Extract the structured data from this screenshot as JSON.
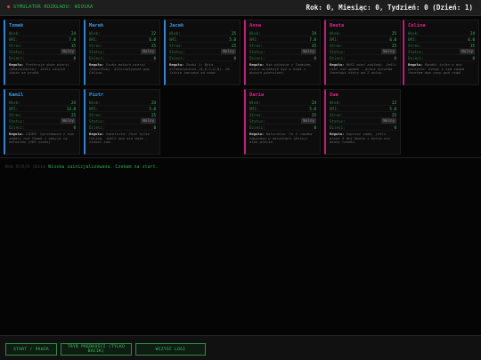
{
  "header": {
    "title": "SYMULATOR ROZKŁADU: WIOSKA",
    "clock": "Rok: 0, Miesiąc: 0, Tydzień: 0 (Dzień: 1)"
  },
  "labels": {
    "age": "Wiek:",
    "bmi": "BMI:",
    "stress": "Stres:",
    "status": "Status:",
    "children": "Dzieci:",
    "rule": "Reguła:"
  },
  "villagers": [
    {
      "name": "Tomek",
      "gender": "male",
      "age": "24",
      "bmi": "7.0",
      "stress": "35",
      "status": "Wolny",
      "children": "0",
      "rule": "Preferuje duże piersi (Beata/Daria). Jeśli wszyte - idzie na przód."
    },
    {
      "name": "Marek",
      "gender": "male",
      "age": "22",
      "bmi": "6.0",
      "stress": "25",
      "status": "Wolny",
      "children": "0",
      "rule": "Szuka małych piersi (Anna/Ewa). Alternatywnie gdy Celina."
    },
    {
      "name": "Jacek",
      "gender": "male",
      "age": "25",
      "bmi": "5.0",
      "stress": "25",
      "status": "Wolny",
      "children": "0",
      "rule": "Znaki 1: Byta alfabetycznie (A,E,C,D,B). Ze liście zaczyna od nowa."
    },
    {
      "name": "Anna",
      "gender": "female",
      "age": "24",
      "bmi": "7.0",
      "stress": "35",
      "status": "Wolny",
      "children": "0",
      "rule": "Nie pójdzie z Tomkiem, który oczekuje być w kimś z dużych piersiach."
    },
    {
      "name": "Beata",
      "gender": "female",
      "age": "25",
      "bmi": "6.0",
      "stress": "25",
      "status": "Wolny",
      "children": "0",
      "rule": "MUSI mieć zakłady. Jeśli nikt nie wpada - praca sprzeda facetowi który ma 2 wolny."
    },
    {
      "name": "Celina",
      "gender": "female",
      "age": "24",
      "bmi": "6.0",
      "stress": "35",
      "status": "Wolny",
      "children": "0",
      "rule": "Randki tylko w dni parzyste. Kiedy z tym samym facetem dwa razy pod rząd."
    },
    {
      "name": "Kamil",
      "gender": "male",
      "age": "24",
      "bmi": "13.0",
      "stress": "25",
      "status": "Wolny",
      "children": "0",
      "rule": "LIDER: Sprzedawca z kim zadali nie Tomek i zdejje tą kelnerem (50% szans)."
    },
    {
      "name": "Piotr",
      "gender": "male",
      "age": "24",
      "bmi": "5.0",
      "stress": "25",
      "status": "Wolny",
      "children": "0",
      "rule": "Idealista: Chce tylko Celinę. Jeśli ona nie może - siedzi sam."
    },
    {
      "name": "Daria",
      "gender": "female",
      "age": "24",
      "bmi": "5.0",
      "stress": "35",
      "status": "Wolny",
      "children": "0",
      "rule": "Naturalna. Co 4 randka odwiedza w obrzeżach (Kolej) albo plecie."
    },
    {
      "name": "Ewa",
      "gender": "female",
      "age": "22",
      "bmi": "5.0",
      "stress": "25",
      "status": "Wolny",
      "children": "0",
      "rule": "Zaprosi sama, jeśli przez 3 dni Beata i Daria nie miały randki."
    }
  ],
  "log": {
    "timestamp": "Rok 0/0/0 (Dzie",
    "message": "Wioska zainicjalizowana. Czekam na start."
  },
  "buttons": {
    "start": "START / PAUZA",
    "speed": "TRYB PRĘDKOŚCI (TYLKO BACIK)",
    "clear": "WCZYŚĆ LOGI"
  },
  "colors": {
    "male_accent": "#2f86d6",
    "female_accent": "#c8197c",
    "positive": "#3fc46a",
    "background": "#050505"
  }
}
